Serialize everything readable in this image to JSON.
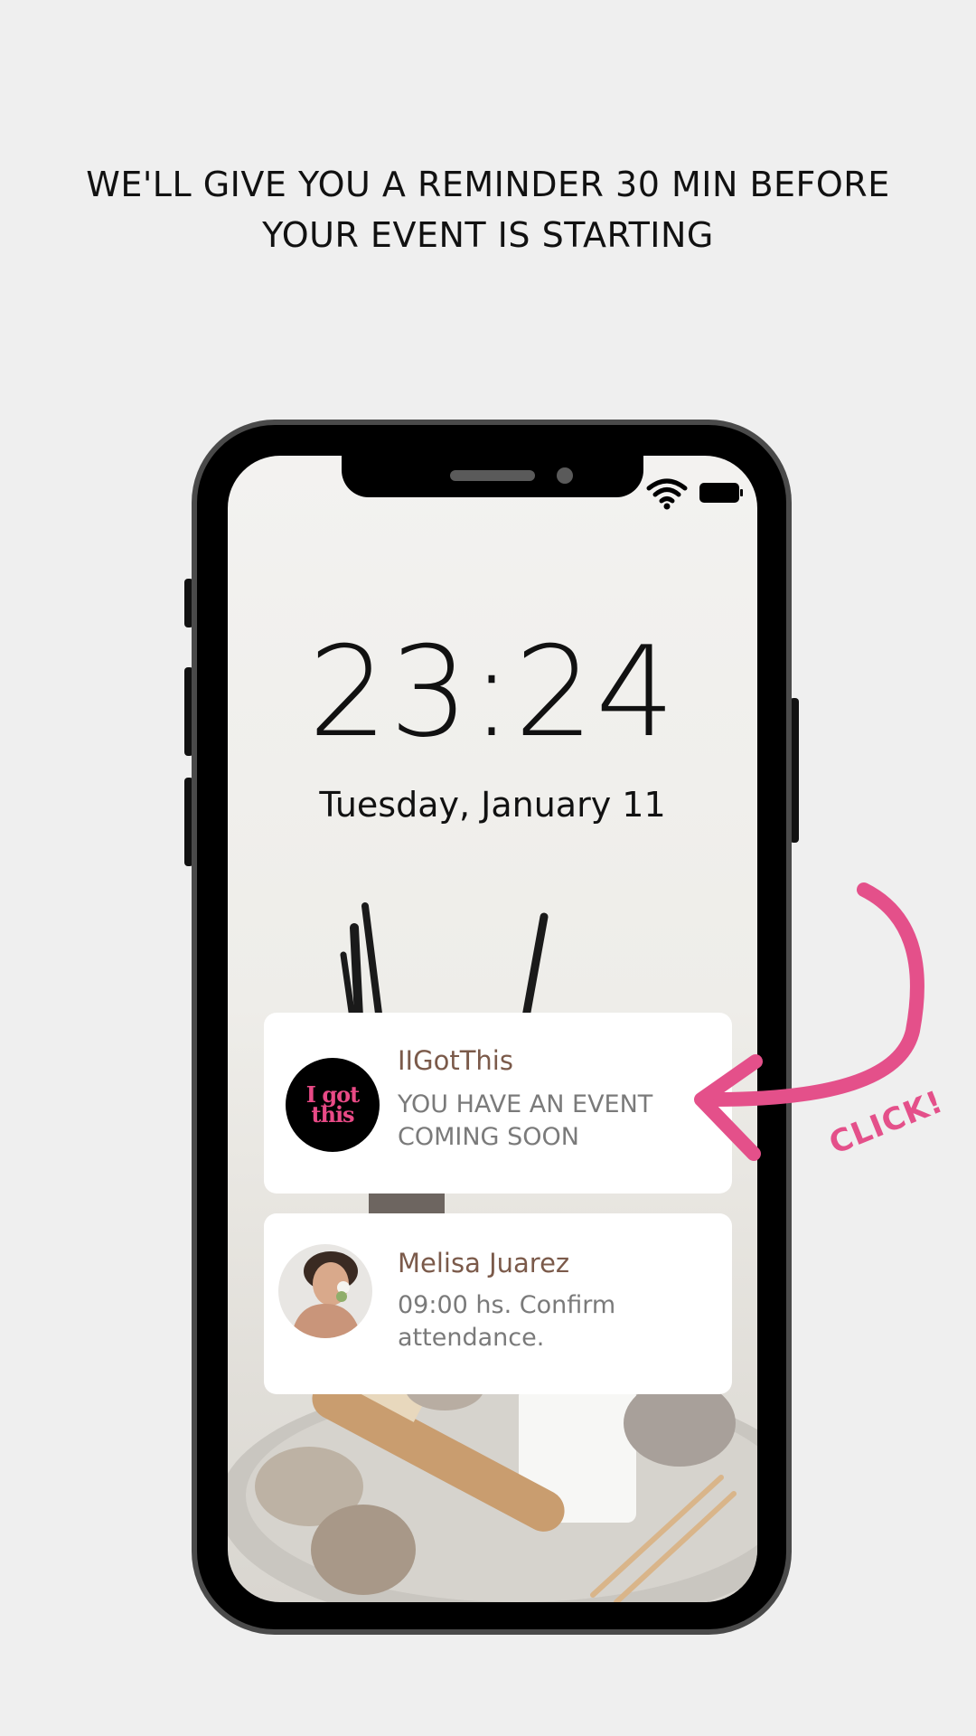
{
  "headline": {
    "line1": "WE'LL GIVE YOU A REMINDER 30 MIN BEFORE",
    "line2": "YOUR EVENT IS STARTING"
  },
  "lockscreen": {
    "time": "23:24",
    "date": "Tuesday, January 11",
    "status_icons": [
      "wifi-icon",
      "battery-icon"
    ]
  },
  "notifications": [
    {
      "app": "IIGotThis",
      "message": "YOU HAVE AN EVENT COMING SOON",
      "avatar": "i-got-this-logo",
      "avatar_text_line1": "I got",
      "avatar_text_line2": "this"
    },
    {
      "app": "Melisa Juarez",
      "message": "09:00 hs. Confirm attendance.",
      "avatar": "user-photo"
    }
  ],
  "callout": {
    "label": "CLICK!",
    "icon": "curved-arrow-icon"
  },
  "colors": {
    "background": "#efefef",
    "accent_pink": "#e4508a",
    "notification_title": "#7b5a4a",
    "notification_body": "#7a7a7a"
  }
}
